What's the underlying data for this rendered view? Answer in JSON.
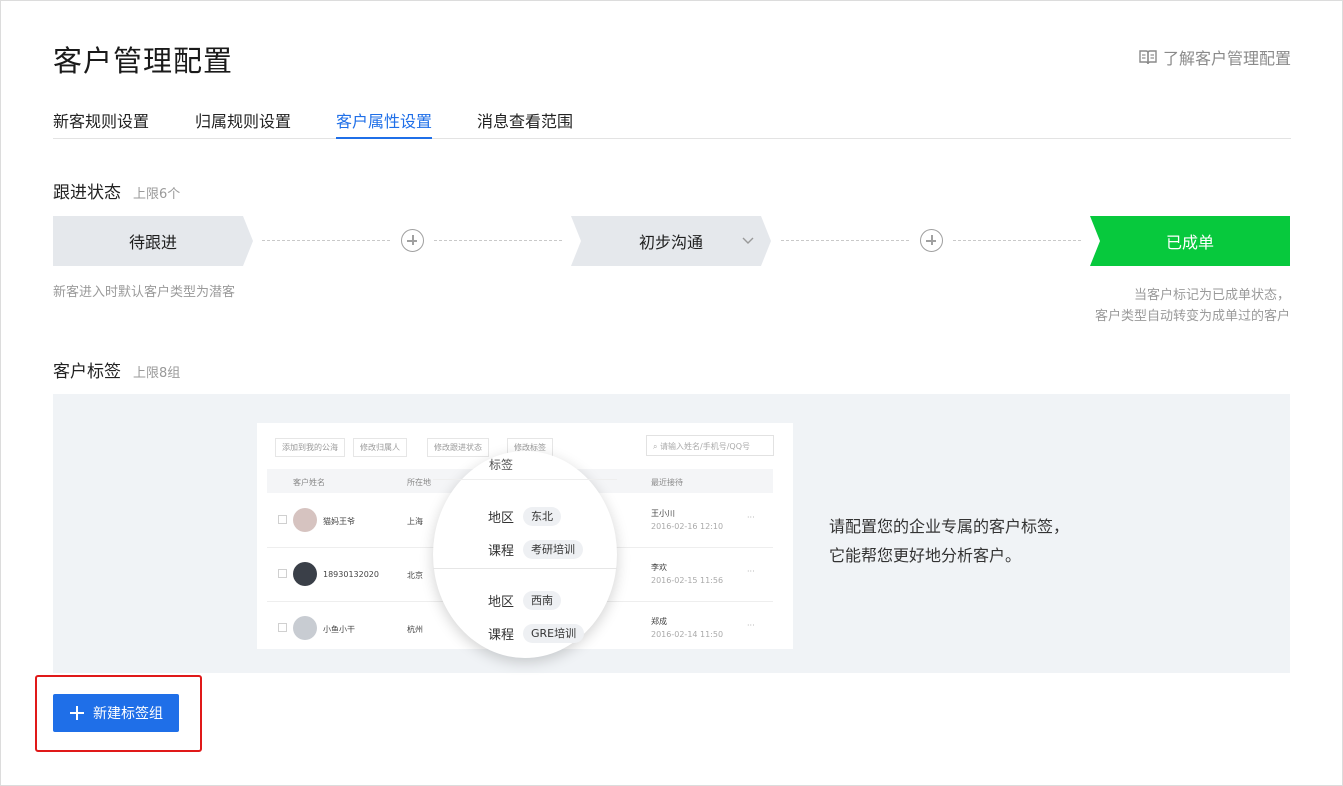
{
  "header": {
    "title": "客户管理配置",
    "help_link": "了解客户管理配置",
    "help_icon": "book-icon"
  },
  "tabs": [
    {
      "label": "新客规则设置",
      "active": false
    },
    {
      "label": "归属规则设置",
      "active": false
    },
    {
      "label": "客户属性设置",
      "active": true
    },
    {
      "label": "消息查看范围",
      "active": false
    }
  ],
  "follow_status": {
    "title": "跟进状态",
    "limit": "上限6个",
    "stages": [
      {
        "label": "待跟进"
      },
      {
        "label": "初步沟通"
      },
      {
        "label": "已成单"
      }
    ],
    "note_left": "新客进入时默认客户类型为潜客",
    "note_right": [
      "当客户标记为已成单状态，",
      "客户类型自动转变为成单过的客户"
    ]
  },
  "customer_tags": {
    "title": "客户标签",
    "limit": "上限8组",
    "description": [
      "请配置您的企业专属的客户标签，",
      "它能帮您更好地分析客户。"
    ],
    "preview": {
      "toolbar": [
        "添加到我的公海",
        "修改归属人",
        "修改跟进状态",
        "修改标签"
      ],
      "search_placeholder": "请输入姓名/手机号/QQ号",
      "columns": [
        "客户姓名",
        "所在地",
        "最近接待"
      ],
      "rows": [
        {
          "name": "猫妈王爷",
          "city": "上海",
          "agent": "王小川",
          "date": "2016-02-16  12:10"
        },
        {
          "name": "18930132020",
          "city": "北京",
          "agent": "李欢",
          "date": "2016-02-15  11:56"
        },
        {
          "name": "小鱼小干",
          "city": "杭州",
          "agent": "郑成",
          "date": "2016-02-14  11:50"
        }
      ],
      "lens": {
        "header": "标签",
        "groups": [
          [
            {
              "key": "地区",
              "value": "东北"
            },
            {
              "key": "课程",
              "value": "考研培训"
            }
          ],
          [
            {
              "key": "地区",
              "value": "西南"
            },
            {
              "key": "课程",
              "value": "GRE培训"
            }
          ]
        ]
      }
    }
  },
  "actions": {
    "new_tag_group": "新建标签组"
  },
  "colors": {
    "primary": "#1f6fe8",
    "success": "#07c93d",
    "highlight": "#e01919"
  }
}
